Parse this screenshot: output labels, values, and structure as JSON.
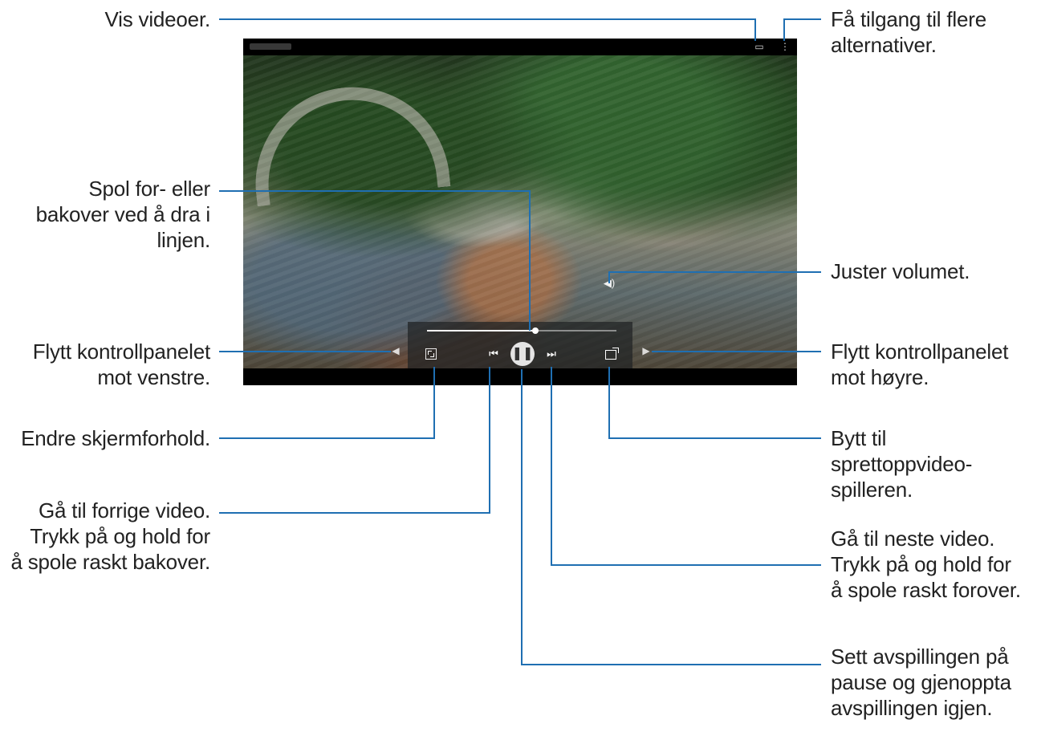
{
  "callouts": {
    "show_videos": "Vis videoer.",
    "more_options": "Få tilgang til flere\nalternativer.",
    "scrub": "Spol for- eller\nbakover ved å dra i\nlinjen.",
    "volume": "Juster volumet.",
    "move_left": "Flytt kontrollpanelet\nmot venstre.",
    "move_right": "Flytt kontrollpanelet\nmot høyre.",
    "aspect_ratio": "Endre skjermforhold.",
    "popup_player": "Bytt til\nsprettoppvideo-\nspilleren.",
    "previous_video": "Gå til forrige video.\nTrykk på og hold for\nå spole raskt bakover.",
    "next_video": "Gå til neste video.\nTrykk på og hold for\nå spole raskt forover.",
    "pause_resume": "Sett avspillingen på\npause og gjenoppta\navspillingen igjen."
  },
  "player": {
    "progress_fraction": 0.57,
    "icons": [
      "videos-icon",
      "more-options-icon",
      "move-left-arrow-icon",
      "move-right-arrow-icon",
      "aspect-ratio-icon",
      "previous-icon",
      "pause-icon",
      "next-icon",
      "popup-player-icon",
      "volume-icon"
    ]
  },
  "colors": {
    "leader": "#1f6fb2",
    "text": "#222222",
    "player_bar": "#000000",
    "control_panel": "#202224"
  }
}
